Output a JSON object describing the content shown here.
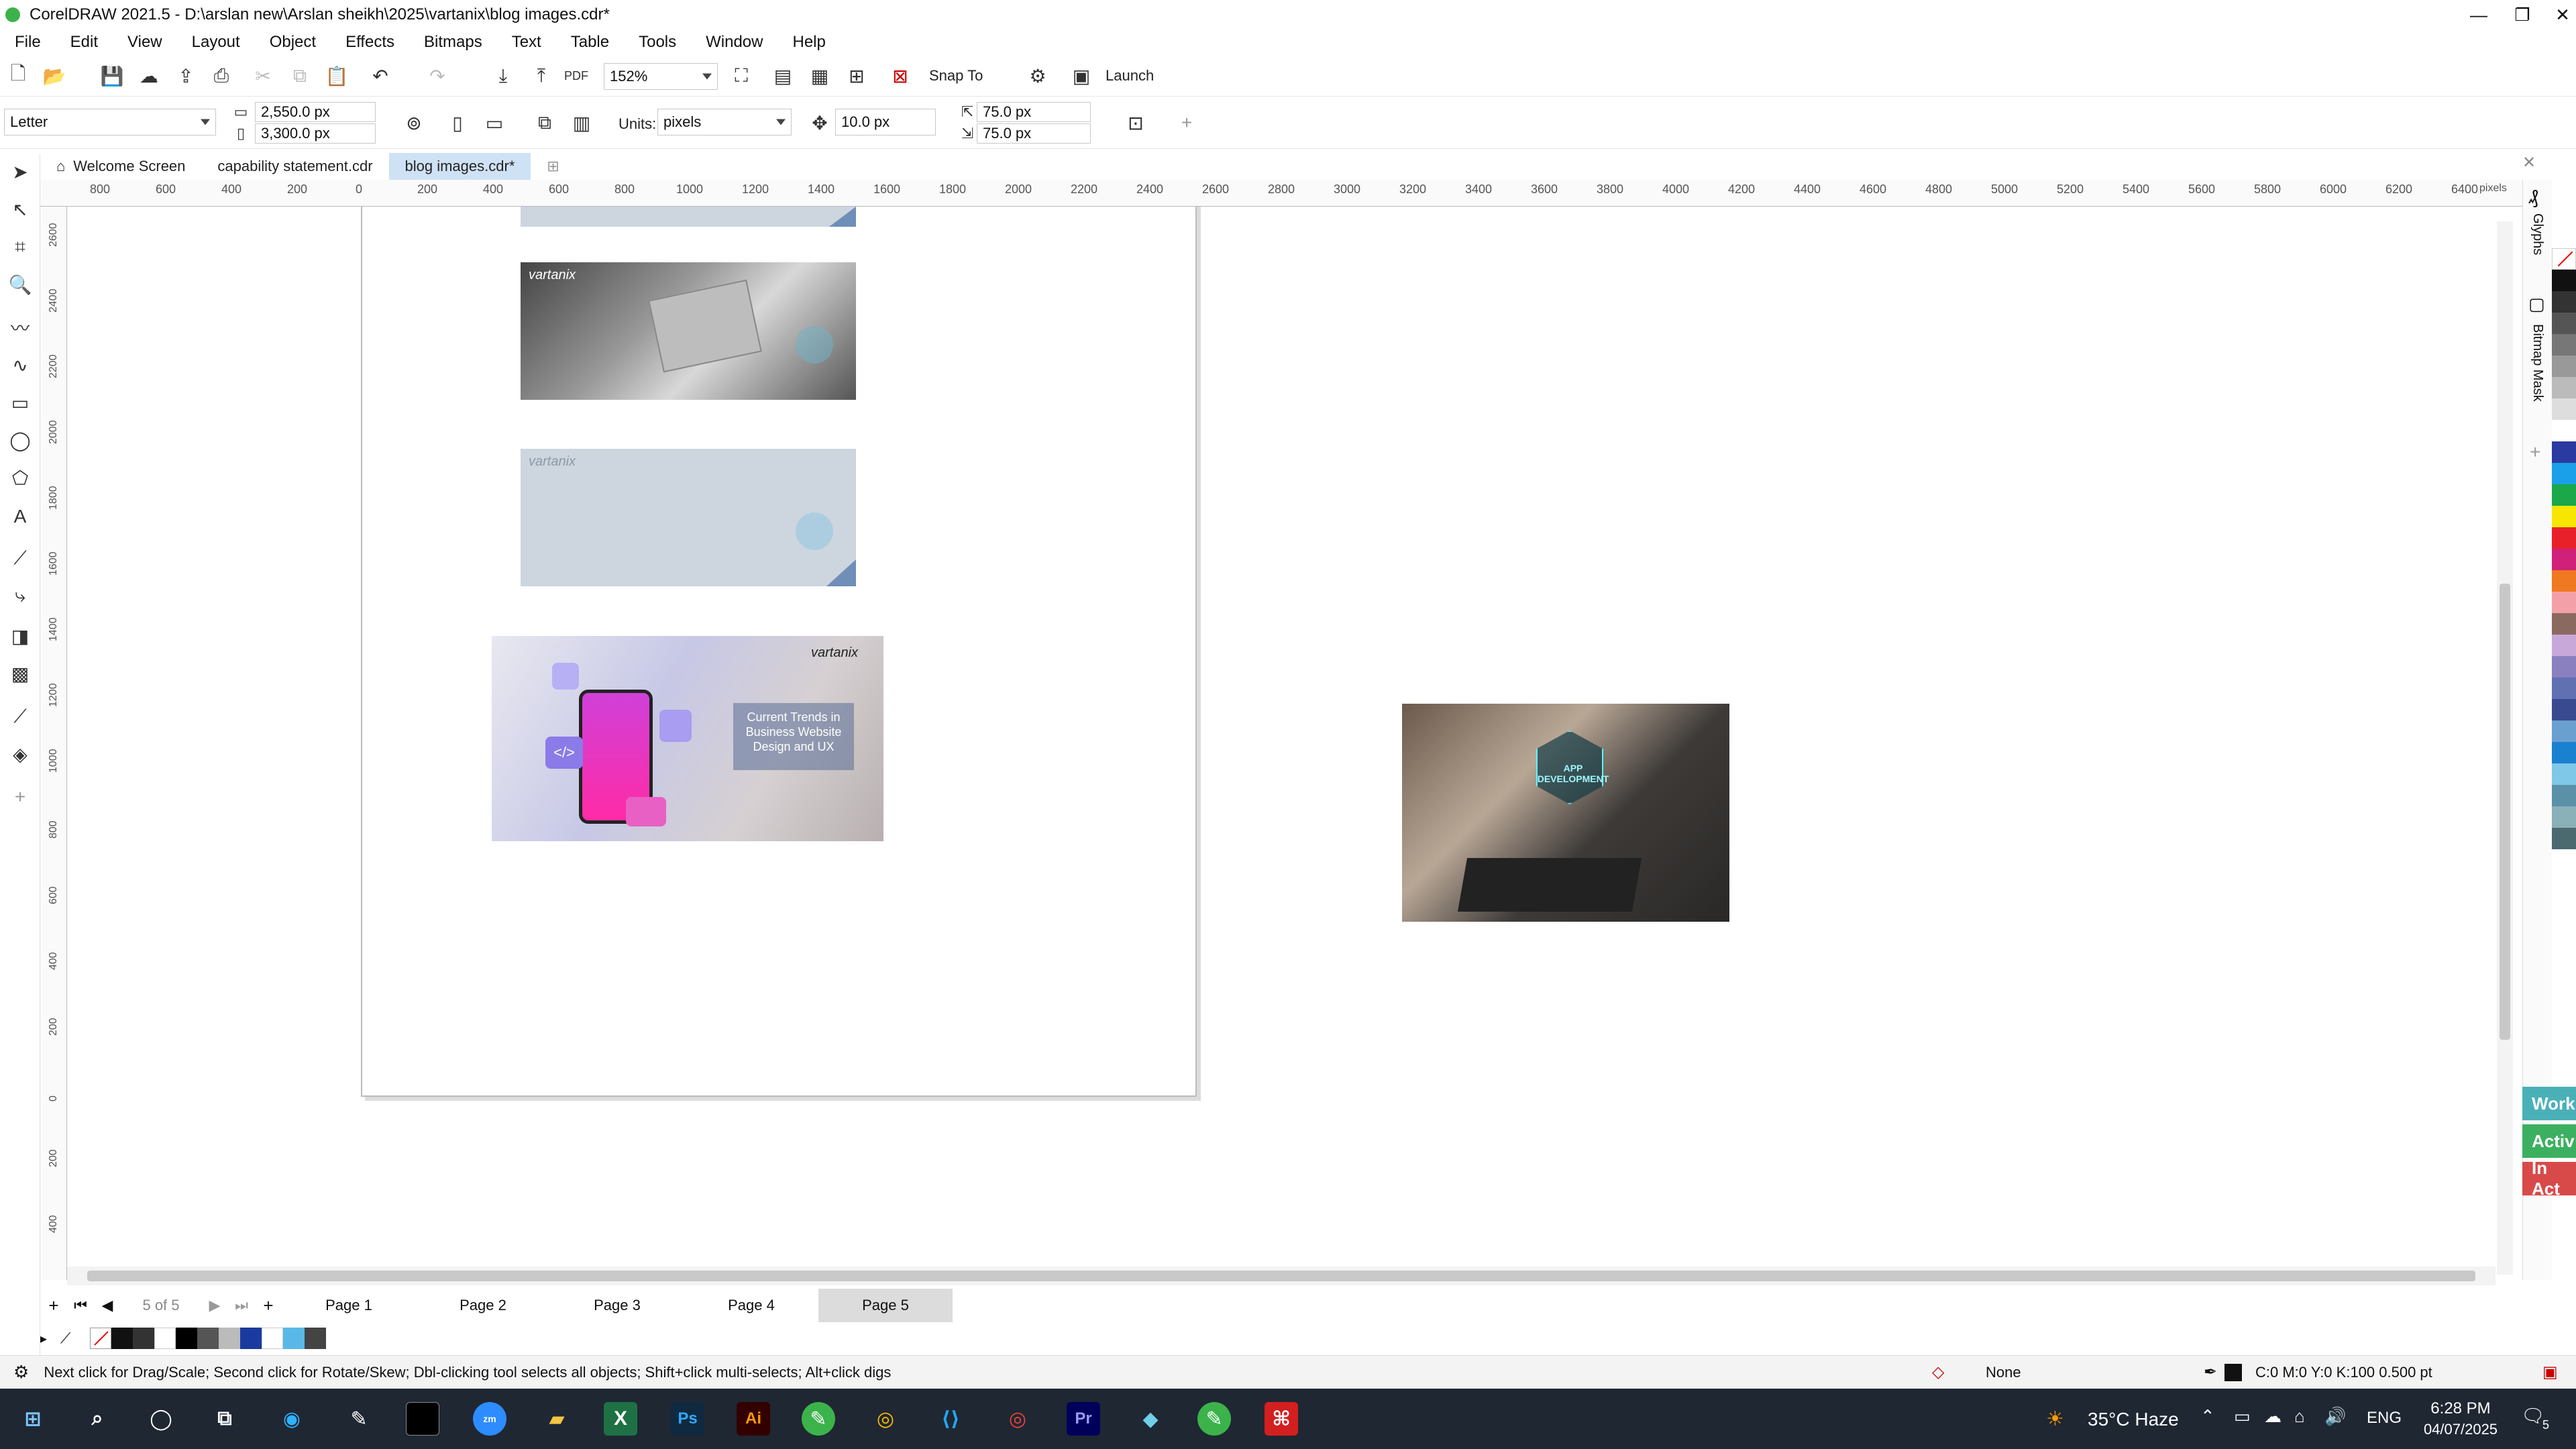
{
  "window": {
    "title": "CorelDRAW 2021.5 - D:\\arslan new\\Arslan sheikh\\2025\\vartanix\\blog images.cdr*"
  },
  "menu": [
    "File",
    "Edit",
    "View",
    "Layout",
    "Object",
    "Effects",
    "Bitmaps",
    "Text",
    "Table",
    "Tools",
    "Window",
    "Help"
  ],
  "toolbar": {
    "zoom": "152%",
    "snap_label": "Snap To",
    "launch_label": "Launch"
  },
  "property_bar": {
    "page_size": "Letter",
    "width": "2,550.0 px",
    "height": "3,300.0 px",
    "units_label": "Units:",
    "units_value": "pixels",
    "nudge": "10.0 px",
    "dup_x": "75.0 px",
    "dup_y": "75.0 px"
  },
  "tabs": [
    "Welcome Screen",
    "capability statement.cdr",
    "blog images.cdr*"
  ],
  "ruler": {
    "h_ticks": [
      "800",
      "600",
      "400",
      "200",
      "0",
      "200",
      "400",
      "600",
      "800",
      "1000",
      "1200",
      "1400",
      "1600",
      "1800",
      "2000",
      "2200",
      "2400",
      "2600",
      "2800",
      "3000",
      "3200",
      "3400",
      "3600",
      "3800",
      "4000",
      "4200",
      "4400",
      "4600",
      "4800",
      "5000",
      "5200",
      "5400",
      "5600",
      "5800",
      "6000",
      "6200",
      "6400"
    ],
    "unit": "pixels",
    "v_ticks": [
      "2600",
      "2400",
      "2200",
      "2000",
      "1800",
      "1600",
      "1400",
      "1200",
      "1000",
      "800",
      "600",
      "400",
      "200",
      "0",
      "200",
      "400"
    ]
  },
  "canvas": {
    "logo_text": "vartanix",
    "blog_card_text": "Current Trends in Business Website Design and UX",
    "app_dev_text": "APP DEVELOPMENT"
  },
  "side_panels": {
    "glyphs": "Glyphs",
    "bitmap_mask": "Bitmap Mask"
  },
  "side_badges": [
    "Work",
    "Activ",
    "In Act"
  ],
  "page_nav": {
    "count": "5 of 5",
    "pages": [
      "Page 1",
      "Page 2",
      "Page 3",
      "Page 4",
      "Page 5"
    ]
  },
  "status": {
    "hint": "Next click for Drag/Scale; Second click for Rotate/Skew; Dbl-clicking tool selects all objects; Shift+click multi-selects; Alt+click digs",
    "fill": "None",
    "outline": "C:0 M:0 Y:0 K:100  0.500 pt"
  },
  "taskbar": {
    "weather": "35°C  Haze",
    "lang": "ENG",
    "time": "6:28 PM",
    "date": "04/07/2025",
    "notif": "5"
  },
  "colors": {
    "accent": "#cfe1f5",
    "taskbar": "#1f2733",
    "brand_green": "#3bb34a"
  }
}
